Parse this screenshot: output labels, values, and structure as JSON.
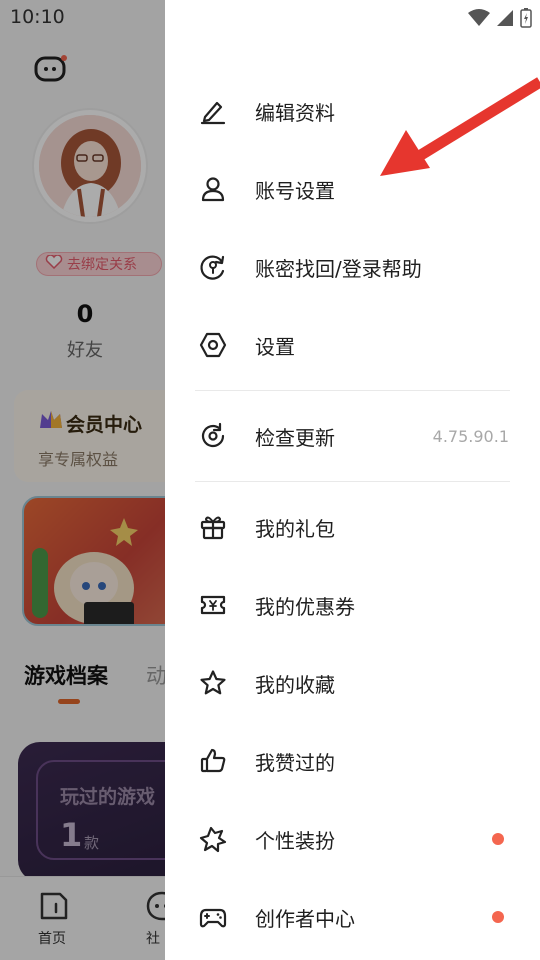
{
  "status_bar": {
    "time": "10:10"
  },
  "profile": {
    "bind_badge": "去绑定关系",
    "friends_count": "0",
    "friends_label": "好友",
    "vip_title": "会员中心",
    "vip_subtitle": "享专属权益",
    "tabs": [
      "游戏档案",
      "动"
    ],
    "played_label": "玩过的游戏",
    "played_count": "1",
    "played_unit": "款"
  },
  "bottom_nav": {
    "home": "首页",
    "social": "社"
  },
  "drawer": {
    "items": [
      {
        "label": "编辑资料",
        "icon": "edit-icon"
      },
      {
        "label": "账号设置",
        "icon": "user-icon"
      },
      {
        "label": "账密找回/登录帮助",
        "icon": "recover-icon"
      },
      {
        "label": "设置",
        "icon": "settings-icon"
      },
      {
        "label": "检查更新",
        "icon": "refresh-icon",
        "value": "4.75.90.1"
      },
      {
        "label": "我的礼包",
        "icon": "gift-icon"
      },
      {
        "label": "我的优惠券",
        "icon": "coupon-icon"
      },
      {
        "label": "我的收藏",
        "icon": "star-icon"
      },
      {
        "label": "我赞过的",
        "icon": "thumbs-up-icon"
      },
      {
        "label": "个性装扮",
        "icon": "puzzle-icon",
        "badge": true
      },
      {
        "label": "创作者中心",
        "icon": "gamepad-icon",
        "badge": true
      }
    ]
  },
  "colors": {
    "accent_dot": "#f4664f",
    "arrow": "#e6362e",
    "tab_underline": "#e0662a"
  }
}
